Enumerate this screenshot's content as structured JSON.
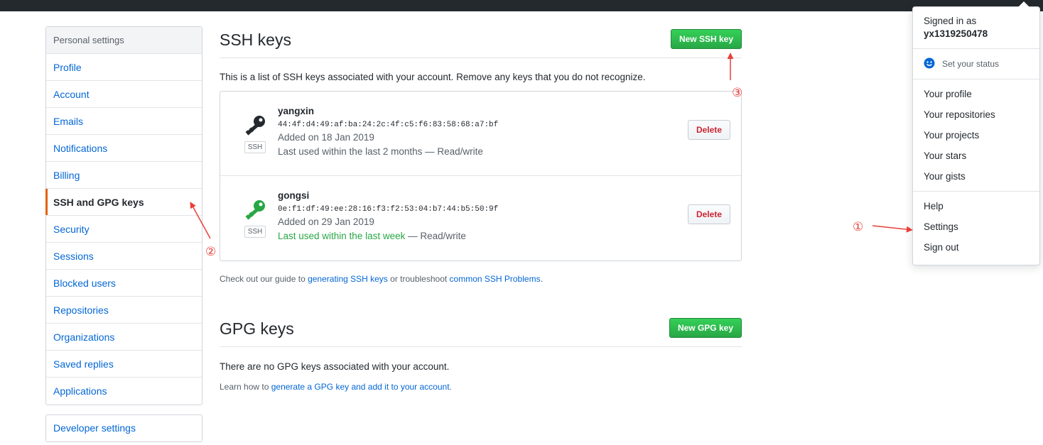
{
  "sidebar": {
    "heading": "Personal settings",
    "items": [
      {
        "label": "Profile"
      },
      {
        "label": "Account"
      },
      {
        "label": "Emails"
      },
      {
        "label": "Notifications"
      },
      {
        "label": "Billing"
      },
      {
        "label": "SSH and GPG keys",
        "selected": true
      },
      {
        "label": "Security"
      },
      {
        "label": "Sessions"
      },
      {
        "label": "Blocked users"
      },
      {
        "label": "Repositories"
      },
      {
        "label": "Organizations"
      },
      {
        "label": "Saved replies"
      },
      {
        "label": "Applications"
      }
    ],
    "developer_settings": "Developer settings"
  },
  "ssh": {
    "title": "SSH keys",
    "new_button": "New SSH key",
    "description": "This is a list of SSH keys associated with your account. Remove any keys that you do not recognize.",
    "keys": [
      {
        "name": "yangxin",
        "fingerprint": "44:4f:d4:49:af:ba:24:2c:4f:c5:f6:83:58:68:a7:bf",
        "added": "Added on 18 Jan 2019",
        "last_used": "Last used within the last 2 months",
        "last_used_recent": "",
        "access": " — Read/write",
        "badge": "SSH",
        "icon_color": "#24292e",
        "delete_label": "Delete"
      },
      {
        "name": "gongsi",
        "fingerprint": "0e:f1:df:49:ee:28:16:f3:f2:53:04:b7:44:b5:50:9f",
        "added": "Added on 29 Jan 2019",
        "last_used": "",
        "last_used_recent": "Last used within the last week",
        "access": " — Read/write",
        "badge": "SSH",
        "icon_color": "#28a745",
        "delete_label": "Delete"
      }
    ],
    "guide_prefix": "Check out our guide to ",
    "guide_link1": "generating SSH keys",
    "guide_mid": " or troubleshoot ",
    "guide_link2": "common SSH Problems",
    "guide_suffix": "."
  },
  "gpg": {
    "title": "GPG keys",
    "new_button": "New GPG key",
    "empty_text": "There are no GPG keys associated with your account.",
    "learn_prefix": "Learn how to ",
    "learn_link": "generate a GPG key and add it to your account",
    "learn_suffix": "."
  },
  "dropdown": {
    "signed_in_as": "Signed in as",
    "username": "yx1319250478",
    "set_status": "Set your status",
    "group1": [
      "Your profile",
      "Your repositories",
      "Your projects",
      "Your stars",
      "Your gists"
    ],
    "group2": [
      "Help",
      "Settings",
      "Sign out"
    ]
  },
  "annotations": {
    "one": "①",
    "two": "②",
    "three": "③",
    "color": "#e8403a"
  }
}
